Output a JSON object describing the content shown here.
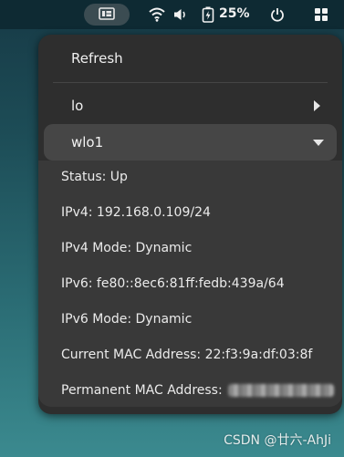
{
  "topbar": {
    "battery_percent": "25%",
    "icons": [
      "app-indicator-icon",
      "wifi-icon",
      "volume-icon",
      "battery-charging-icon",
      "power-icon",
      "app-grid-icon"
    ]
  },
  "menu": {
    "refresh_label": "Refresh",
    "interfaces": [
      {
        "label": "lo",
        "state": "collapsed"
      },
      {
        "label": "wlo1",
        "state": "expanded"
      }
    ],
    "details": {
      "status": "Status: Up",
      "ipv4": "IPv4: 192.168.0.109/24",
      "ipv4_mode": "IPv4 Mode: Dynamic",
      "ipv6": "IPv6: fe80::8ec6:81ff:fedb:439a/64",
      "ipv6_mode": "IPv6 Mode: Dynamic",
      "current_mac": "Current MAC Address: 22:f3:9a:df:03:8f",
      "permanent_mac_label": "Permanent MAC Address:"
    }
  },
  "watermark": "CSDN @廿六-AhJi",
  "colors": {
    "menu_bg": "#2e2e2e",
    "submenu_bg": "#393939",
    "selected_bg": "#464646",
    "topbar_bg": "#0e2a33"
  }
}
